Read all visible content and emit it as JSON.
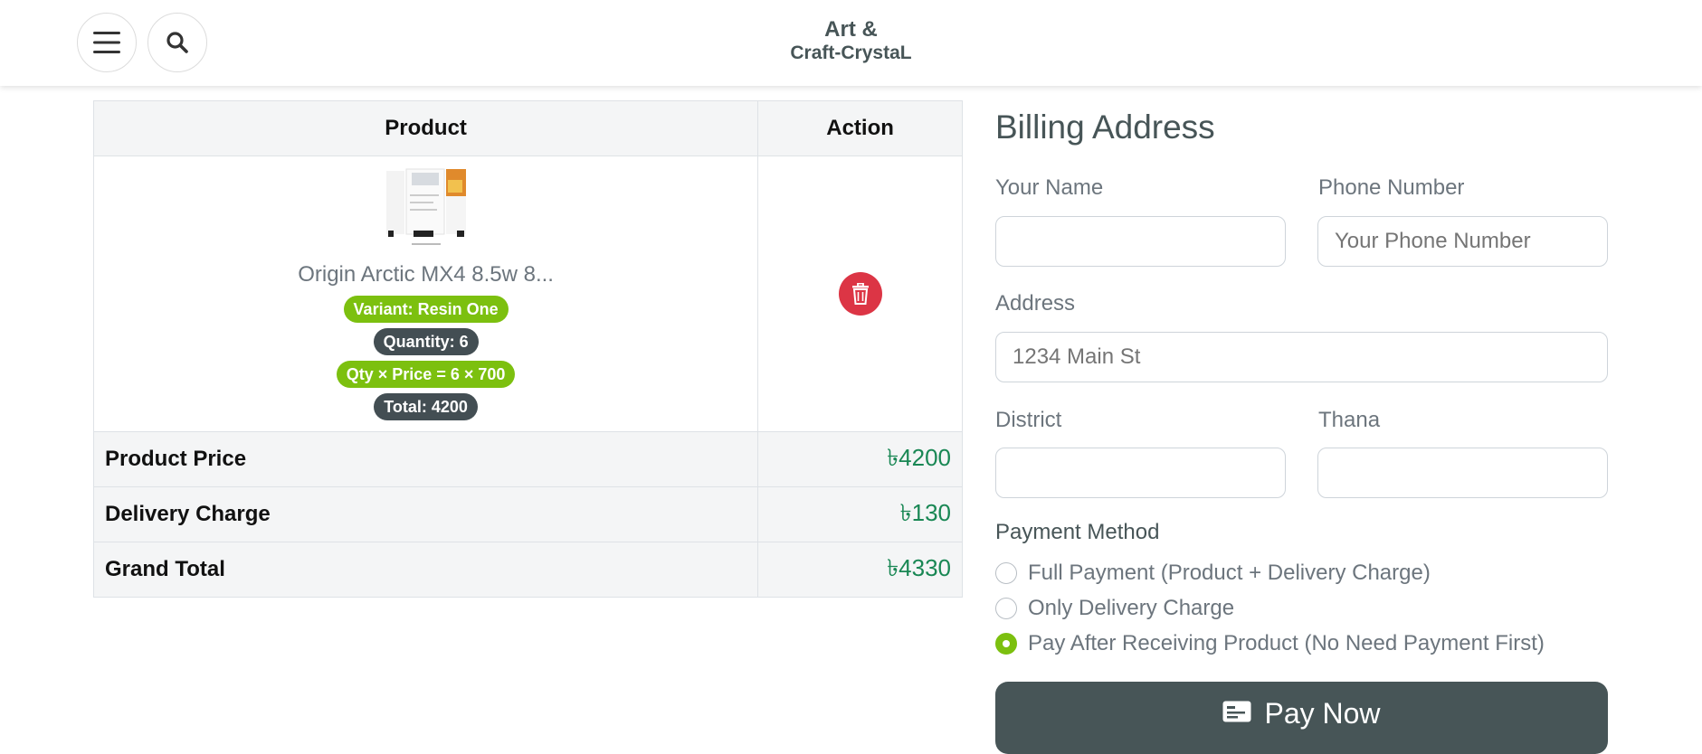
{
  "header": {
    "brand_line1": "Art &",
    "brand_line2": "Craft-CrystaL",
    "menu_icon": "hamburger-menu-icon",
    "search_icon": "search-icon"
  },
  "cart": {
    "columns": [
      "Product",
      "Action"
    ],
    "item": {
      "name": "Origin Arctic MX4 8.5w 8...",
      "variant": "Variant: Resin One",
      "quantity": "Quantity: 6",
      "calc": "Qty × Price = 6 × 700",
      "total": "Total: 4200"
    },
    "summary": [
      {
        "label": "Product Price",
        "value": "৳4200"
      },
      {
        "label": "Delivery Charge",
        "value": "৳130"
      },
      {
        "label": "Grand Total",
        "value": "৳4330"
      }
    ]
  },
  "billing": {
    "title": "Billing Address",
    "name_label": "Your Name",
    "name_value": "",
    "phone_label": "Phone Number",
    "phone_placeholder": "Your Phone Number",
    "address_label": "Address",
    "address_placeholder": "1234 Main St",
    "district_label": "District",
    "district_value": "",
    "thana_label": "Thana",
    "thana_value": "",
    "payment_title": "Payment Method",
    "payment_options": [
      {
        "label": "Full Payment (Product + Delivery Charge)",
        "selected": false
      },
      {
        "label": "Only Delivery Charge",
        "selected": false
      },
      {
        "label": "Pay After Receiving Product (No Need Payment First)",
        "selected": true
      }
    ],
    "pay_button": "Pay Now"
  },
  "colors": {
    "primary_dark": "#475557",
    "accent_green": "#7cc00f",
    "danger": "#dc3545",
    "price_green": "#198754"
  }
}
